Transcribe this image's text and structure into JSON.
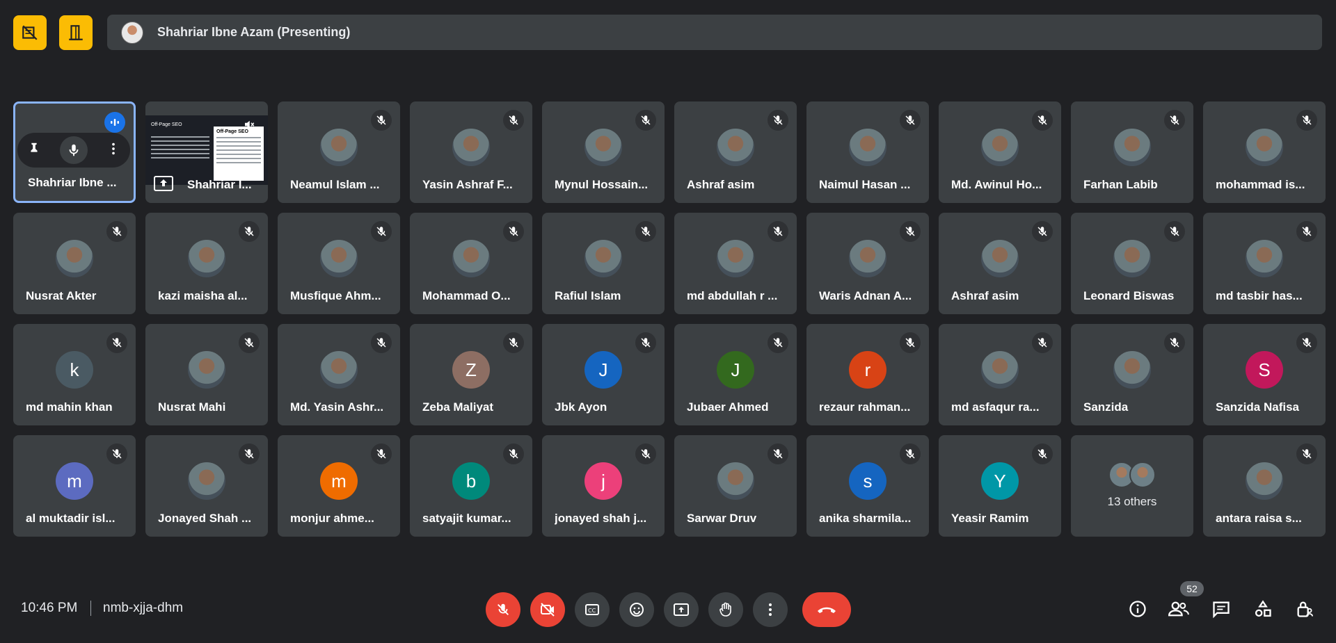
{
  "top": {
    "presenter_text": "Shahriar Ibne Azam (Presenting)"
  },
  "self_tile": {
    "name": "Shahriar Ibne ..."
  },
  "share_tile": {
    "name": "Shahriar I...",
    "slide_title": "Off-Page SEO",
    "slide_title_2": "Off-Page SEO"
  },
  "participants": [
    {
      "name": "Neamul Islam ...",
      "avatar": "photo"
    },
    {
      "name": "Yasin Ashraf F...",
      "avatar": "photo"
    },
    {
      "name": "Mynul Hossain...",
      "avatar": "photo"
    },
    {
      "name": "Ashraf asim",
      "avatar": "photo"
    },
    {
      "name": "Naimul Hasan ...",
      "avatar": "photo"
    },
    {
      "name": "Md. Awinul Ho...",
      "avatar": "photo"
    },
    {
      "name": "Farhan Labib",
      "avatar": "photo"
    },
    {
      "name": "mohammad is...",
      "avatar": "photo"
    },
    {
      "name": "Nusrat Akter",
      "avatar": "photo"
    },
    {
      "name": "kazi maisha al...",
      "avatar": "photo"
    },
    {
      "name": "Musfique Ahm...",
      "avatar": "photo"
    },
    {
      "name": "Mohammad O...",
      "avatar": "photo"
    },
    {
      "name": "Rafiul Islam",
      "avatar": "photo"
    },
    {
      "name": "md abdullah r ...",
      "avatar": "photo"
    },
    {
      "name": "Waris Adnan A...",
      "avatar": "photo"
    },
    {
      "name": "Ashraf asim",
      "avatar": "photo"
    },
    {
      "name": "Leonard Biswas",
      "avatar": "photo"
    },
    {
      "name": "md tasbir has...",
      "avatar": "photo"
    },
    {
      "name": "md mahin khan",
      "avatar": "letter",
      "letter": "k",
      "color": "#4a5a63"
    },
    {
      "name": "Nusrat Mahi",
      "avatar": "photo"
    },
    {
      "name": "Md. Yasin Ashr...",
      "avatar": "photo"
    },
    {
      "name": "Zeba Maliyat",
      "avatar": "letter",
      "letter": "Z",
      "color": "#8d6e63"
    },
    {
      "name": "Jbk Ayon",
      "avatar": "letter",
      "letter": "J",
      "color": "#1565c0"
    },
    {
      "name": "Jubaer Ahmed",
      "avatar": "letter",
      "letter": "J",
      "color": "#33691e"
    },
    {
      "name": "rezaur rahman...",
      "avatar": "letter",
      "letter": "r",
      "color": "#d84315"
    },
    {
      "name": "md asfaqur ra...",
      "avatar": "photo"
    },
    {
      "name": "Sanzida",
      "avatar": "photo"
    },
    {
      "name": "Sanzida Nafisa",
      "avatar": "letter",
      "letter": "S",
      "color": "#c2185b"
    },
    {
      "name": "al muktadir isl...",
      "avatar": "letter",
      "letter": "m",
      "color": "#5c6bc0"
    },
    {
      "name": "Jonayed Shah ...",
      "avatar": "photo"
    },
    {
      "name": "monjur ahme...",
      "avatar": "letter",
      "letter": "m",
      "color": "#ef6c00"
    },
    {
      "name": "satyajit kumar...",
      "avatar": "letter",
      "letter": "b",
      "color": "#00897b"
    },
    {
      "name": "jonayed shah j...",
      "avatar": "letter",
      "letter": "j",
      "color": "#ec407a"
    },
    {
      "name": "Sarwar Druv",
      "avatar": "photo"
    },
    {
      "name": "anika sharmila...",
      "avatar": "letter",
      "letter": "s",
      "color": "#1565c0"
    },
    {
      "name": "Yeasir Ramim",
      "avatar": "letter",
      "letter": "Y",
      "color": "#0097a7"
    },
    {
      "name": "13 others",
      "avatar": "others"
    },
    {
      "name": "antara raisa s...",
      "avatar": "photo"
    }
  ],
  "bottom": {
    "time": "10:46 PM",
    "meeting_code": "nmb-xjja-dhm",
    "people_count": "52"
  }
}
